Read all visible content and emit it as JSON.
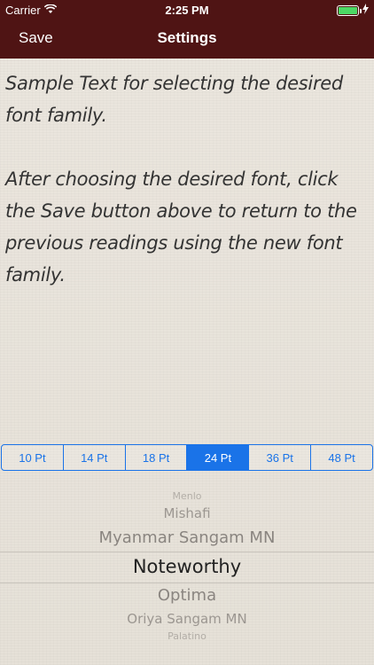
{
  "status_bar": {
    "carrier": "Carrier",
    "time": "2:25 PM",
    "wifi_icon": "wifi-icon",
    "battery_icon": "battery-icon",
    "charging_icon": "charging-bolt-icon"
  },
  "nav": {
    "save_label": "Save",
    "title": "Settings"
  },
  "sample": {
    "paragraph1": "Sample Text for selecting the desired font family.",
    "paragraph2": "After choosing the desired font, click the Save button above to return to the previous readings using the new font family."
  },
  "sizes": {
    "options": [
      "10 Pt",
      "14 Pt",
      "18 Pt",
      "24 Pt",
      "36 Pt",
      "48 Pt"
    ],
    "selected": "24 Pt"
  },
  "font_picker": {
    "items": [
      "Menlo",
      "Mishafi",
      "Myanmar Sangam MN",
      "Noteworthy",
      "Optima",
      "Oriya Sangam MN",
      "Palatino"
    ],
    "selected": "Noteworthy"
  },
  "colors": {
    "header": "#4f1414",
    "accent": "#1a73e8",
    "battery": "#4cd964"
  }
}
